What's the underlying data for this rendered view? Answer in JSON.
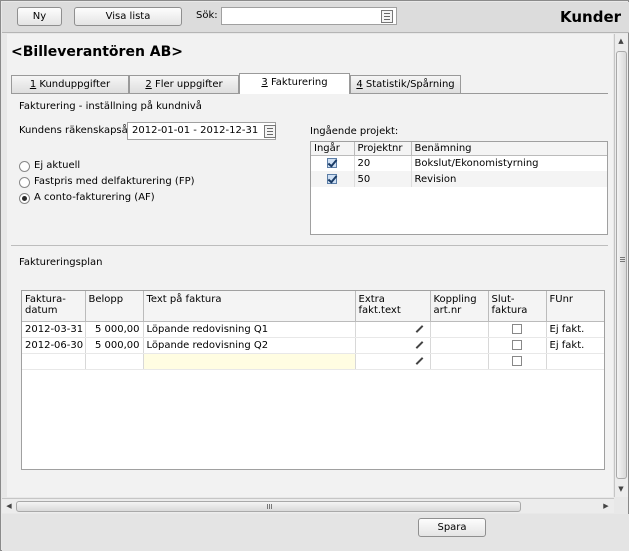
{
  "toolbar": {
    "new_label": "Ny",
    "show_list_label": "Visa lista",
    "search_label": "Sök:",
    "search_value": "",
    "section_title": "Kunder"
  },
  "customer": {
    "name": "<Billeverantören AB>"
  },
  "tabs": [
    {
      "key": "1",
      "rest": " Kunduppgifter",
      "active": false
    },
    {
      "key": "2",
      "rest": " Fler uppgifter",
      "active": false
    },
    {
      "key": "3",
      "rest": " Fakturering",
      "active": true
    },
    {
      "key": "4",
      "rest": " Statistik/Spårning",
      "active": false
    }
  ],
  "billing": {
    "section_heading": "Fakturering - inställning på kundnivå",
    "fiscal_year_label": "Kundens räkenskapsår:",
    "fiscal_year_value": "2012-01-01 - 2012-12-31",
    "options": [
      {
        "label": "Ej aktuell",
        "selected": false
      },
      {
        "label": "Fastpris med delfakturering (FP)",
        "selected": false
      },
      {
        "label": "A conto-fakturering (AF)",
        "selected": true
      }
    ]
  },
  "projects": {
    "heading": "Ingående projekt:",
    "columns": [
      "Ingår",
      "Projektnr",
      "Benämning"
    ],
    "rows": [
      {
        "included": true,
        "number": "20",
        "name": "Bokslut/Ekonomistyrning"
      },
      {
        "included": true,
        "number": "50",
        "name": "Revision"
      }
    ]
  },
  "plan": {
    "heading": "Faktureringsplan",
    "columns": {
      "date": [
        "Faktura-",
        "datum"
      ],
      "amount": "Belopp",
      "text": "Text på faktura",
      "extra": [
        "Extra",
        "fakt.text"
      ],
      "link": [
        "Koppling",
        "art.nr"
      ],
      "final": [
        "Slut-",
        "faktura"
      ],
      "funr": "FUnr"
    },
    "rows": [
      {
        "date": "2012-03-31",
        "amount": "5 000,00",
        "text": "Löpande redovisning Q1",
        "funr": "Ej fakt."
      },
      {
        "date": "2012-06-30",
        "amount": "5 000,00",
        "text": "Löpande redovisning Q2",
        "funr": "Ej fakt."
      },
      {
        "date": "",
        "amount": "",
        "text": "",
        "funr": ""
      }
    ]
  },
  "footer": {
    "save_label": "Spara"
  }
}
